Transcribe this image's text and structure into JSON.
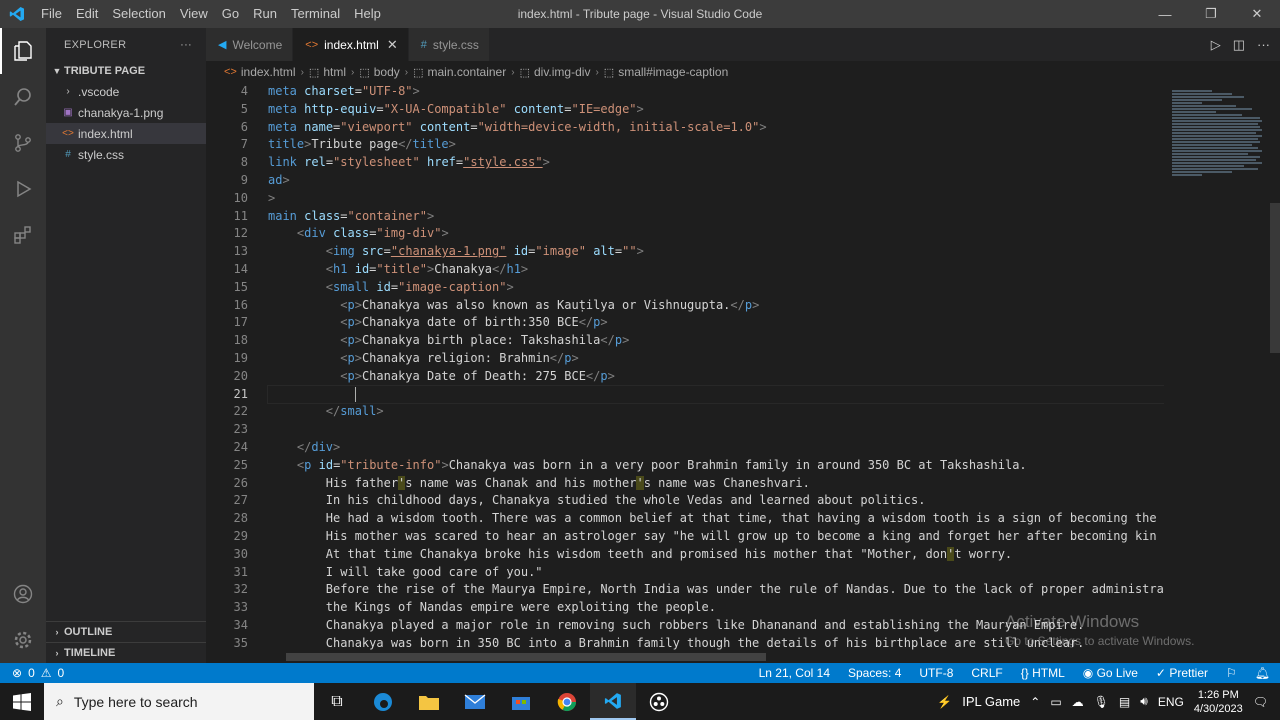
{
  "titlebar": {
    "menu": [
      "File",
      "Edit",
      "Selection",
      "View",
      "Go",
      "Run",
      "Terminal",
      "Help"
    ],
    "title": "index.html - Tribute page - Visual Studio Code"
  },
  "sidebar": {
    "header": "EXPLORER",
    "folder": "TRIBUTE PAGE",
    "files": [
      ".vscode",
      "chanakya-1.png",
      "index.html",
      "style.css"
    ],
    "outline": "OUTLINE",
    "timeline": "TIMELINE"
  },
  "tabs": [
    {
      "label": "Welcome"
    },
    {
      "label": "index.html"
    },
    {
      "label": "style.css"
    }
  ],
  "breadcrumb": [
    "index.html",
    "html",
    "body",
    "main.container",
    "div.img-div",
    "small#image-caption"
  ],
  "line_numbers": [
    "4",
    "5",
    "6",
    "7",
    "8",
    "9",
    "10",
    "11",
    "12",
    "13",
    "14",
    "15",
    "16",
    "17",
    "18",
    "19",
    "20",
    "21",
    "22",
    "23",
    "24",
    "25",
    "26",
    "27",
    "28",
    "29",
    "30",
    "31",
    "32",
    "33",
    "34",
    "35"
  ],
  "code": {
    "l4_a": "charset",
    "l4_s": "\"UTF-8\"",
    "l5_a1": "http-equiv",
    "l5_s1": "\"X-UA-Compatible\"",
    "l5_a2": "content",
    "l5_s2": "\"IE=edge\"",
    "l6_a1": "name",
    "l6_s1": "\"viewport\"",
    "l6_a2": "content",
    "l6_s2": "\"width=device-width, initial-scale=1.0\"",
    "l7_text": "Tribute page",
    "l8_a1": "rel",
    "l8_s1": "\"stylesheet\"",
    "l8_a2": "href",
    "l8_s2": "\"style.css\"",
    "l11_a": "class",
    "l11_s": "\"container\"",
    "l12_a": "class",
    "l12_s": "\"img-div\"",
    "l13_a1": "src",
    "l13_s1": "\"chanakya-1.png\"",
    "l13_a2": "id",
    "l13_s2": "\"image\"",
    "l13_a3": "alt",
    "l13_s3": "\"\"",
    "l14_a": "id",
    "l14_s": "\"title\"",
    "l14_text": "Chanakya",
    "l15_a": "id",
    "l15_s": "\"image-caption\"",
    "l16_text": "Chanakya was also known as Kauṭilya or Vishnugupta.",
    "l17_text": "Chanakya date of birth:350 BCE",
    "l18_text": "Chanakya birth place: Takshashila",
    "l19_text": "Chanakya religion: Brahmin",
    "l20_text": "Chanakya Date of Death: 275 BCE",
    "l25_a": "id",
    "l25_s": "\"tribute-info\"",
    "l25_text": "Chanakya was born in a very poor Brahmin family in around 350 BC at Takshashila.",
    "l26_t1": "His father",
    "l26_t2": "s name was Chanak and his mother",
    "l26_t3": "s name was Chaneshvari.",
    "l27": "In his childhood days, Chanakya studied the whole Vedas and learned about politics.",
    "l28": "He had a wisdom tooth. There was a common belief at that time, that having a wisdom tooth is a sign of becoming the",
    "l29": "His mother was scared to hear an astrologer say \"he will grow up to become a king and forget her after becoming kin",
    "l30_t1": "At that time Chanakya broke his wisdom teeth and promised his mother that \"Mother, don",
    "l30_t2": "t worry.",
    "l31": "I will take good care of you.\"",
    "l32": "Before the rise of the Maurya Empire, North India was under the rule of Nandas. Due to the lack of proper administra",
    "l33": "the Kings of Nandas empire were exploiting the people.",
    "l34": "Chanakya played a major role in removing such robbers like Dhananand and establishing the Mauryan Empire.",
    "l35": "Chanakya was born in 350 BC into a Brahmin family though the details of his birthplace are still unclear."
  },
  "watermark": {
    "line1": "Activate Windows",
    "line2": "Go to Settings to activate Windows."
  },
  "statusbar": {
    "errors": "0",
    "warnings": "0",
    "position": "Ln 21, Col 14",
    "spaces": "Spaces: 4",
    "encoding": "UTF-8",
    "eol": "CRLF",
    "language": "HTML",
    "golive": "Go Live",
    "prettier": "Prettier"
  },
  "taskbar": {
    "search_placeholder": "Type here to search",
    "weather": "IPL Game",
    "lang": "ENG",
    "time": "1:26 PM",
    "date": "4/30/2023"
  },
  "colors": {
    "accent": "#007acc",
    "tag": "#569cd6",
    "attr": "#9cdcfe",
    "string": "#ce9178"
  }
}
